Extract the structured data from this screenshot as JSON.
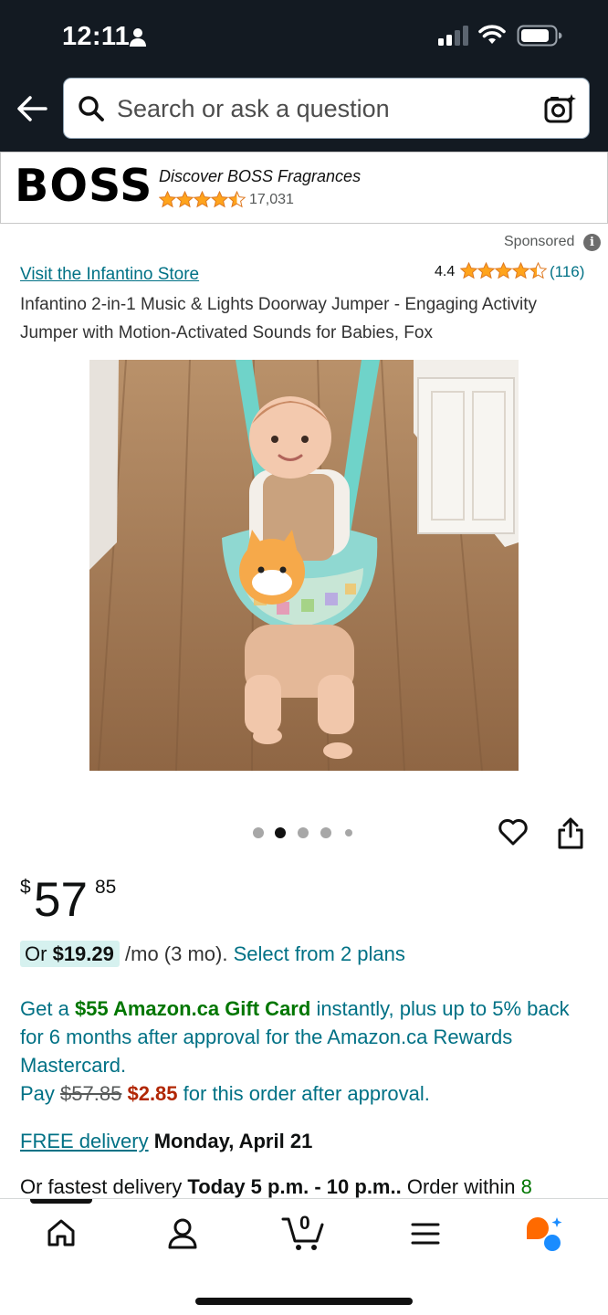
{
  "status": {
    "time": "12:11"
  },
  "search": {
    "placeholder": "Search or ask a question"
  },
  "ad": {
    "brand": "BOSS",
    "tagline": "Discover BOSS Fragrances",
    "rating_count": "17,031",
    "rating": 4.5
  },
  "sponsored": "Sponsored",
  "info_glyph": "i",
  "product": {
    "store_link": "Visit the Infantino Store",
    "rating": "4.4",
    "stars": 4.4,
    "review_count": "(116)",
    "title": "Infantino 2-in-1 Music & Lights Doorway Jumper - Engaging Activity Jumper with Motion-Activated Sounds for Babies, Fox",
    "image_count": 5,
    "active_image": 2
  },
  "price": {
    "symbol": "$",
    "whole": "57",
    "fraction": "85"
  },
  "monthly": {
    "prefix": "Or",
    "amount": "$19.29",
    "suffix": "/mo (3 mo).",
    "link": "Select from 2 plans"
  },
  "promo": {
    "get_a": "Get a",
    "gift_card": "$55 Amazon.ca Gift Card",
    "rest": "instantly, plus up to 5% back for 6 months after approval for the Amazon.ca Rewards Mastercard.",
    "pay": "Pay",
    "old_price": "$57.85",
    "new_price": "$2.85",
    "tail": "for this order after approval."
  },
  "delivery": {
    "free_link": "FREE delivery",
    "date": "Monday, April 21"
  },
  "fastest": {
    "prefix": "Or fastest delivery",
    "window": "Today 5 p.m. - 10 p.m..",
    "order_within": "Order within",
    "countdown": "8"
  },
  "bottom_nav": {
    "cart_count": "0",
    "items": [
      "home-icon",
      "account-icon",
      "cart-icon",
      "menu-icon",
      "rufus-icon"
    ]
  },
  "colors": {
    "header_bg": "#131A22",
    "link": "#007185",
    "price_red": "#B12704",
    "green": "#007600",
    "star": "#FFA41C",
    "installment_bg": "#d6f1ef"
  }
}
